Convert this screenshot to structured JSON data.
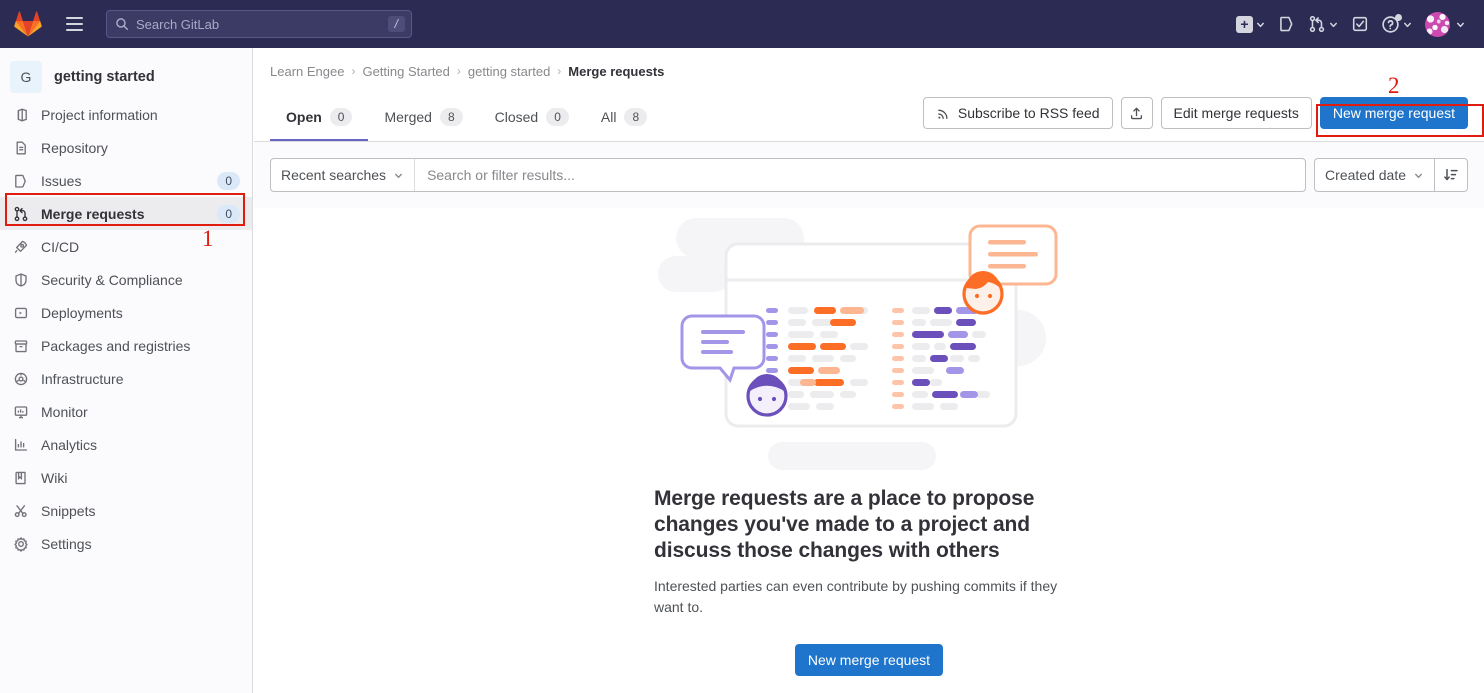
{
  "topbar": {
    "logo_icon": "gitlab-logo-icon",
    "menu_icon": "hamburger-menu-icon",
    "search": {
      "icon": "search-icon",
      "placeholder": "Search GitLab",
      "shortcut_key": "/"
    },
    "actions": [
      {
        "name": "create-new-menu",
        "icon": "plus-square-icon",
        "caret": true
      },
      {
        "name": "issues-link",
        "icon": "issues-icon",
        "caret": false
      },
      {
        "name": "merge-requests-menu",
        "icon": "merge-request-icon",
        "caret": true
      },
      {
        "name": "todos-link",
        "icon": "todo-checkbox-icon",
        "caret": false
      },
      {
        "name": "help-menu",
        "icon": "question-circle-icon",
        "caret": true
      },
      {
        "name": "user-menu",
        "icon": "avatar",
        "caret": true
      }
    ]
  },
  "sidebar": {
    "project": {
      "initial": "G",
      "name": "getting started"
    },
    "items": [
      {
        "label": "Project information",
        "icon": "project-info-icon",
        "badge": null,
        "active": false
      },
      {
        "label": "Repository",
        "icon": "repository-doc-icon",
        "badge": null,
        "active": false
      },
      {
        "label": "Issues",
        "icon": "issues-icon",
        "badge": "0",
        "active": false
      },
      {
        "label": "Merge requests",
        "icon": "merge-request-icon",
        "badge": "0",
        "active": true
      },
      {
        "label": "CI/CD",
        "icon": "rocket-icon",
        "badge": null,
        "active": false
      },
      {
        "label": "Security & Compliance",
        "icon": "shield-icon",
        "badge": null,
        "active": false
      },
      {
        "label": "Deployments",
        "icon": "deployments-icon",
        "badge": null,
        "active": false
      },
      {
        "label": "Packages and registries",
        "icon": "package-icon",
        "badge": null,
        "active": false
      },
      {
        "label": "Infrastructure",
        "icon": "infrastructure-cloud-icon",
        "badge": null,
        "active": false
      },
      {
        "label": "Monitor",
        "icon": "monitor-screen-icon",
        "badge": null,
        "active": false
      },
      {
        "label": "Analytics",
        "icon": "chart-bar-icon",
        "badge": null,
        "active": false
      },
      {
        "label": "Wiki",
        "icon": "book-icon",
        "badge": null,
        "active": false
      },
      {
        "label": "Snippets",
        "icon": "scissors-icon",
        "badge": null,
        "active": false
      },
      {
        "label": "Settings",
        "icon": "gear-icon",
        "badge": null,
        "active": false
      }
    ]
  },
  "breadcrumb": {
    "items": [
      "Learn Engee",
      "Getting Started",
      "getting started"
    ],
    "current": "Merge requests",
    "separator": "›"
  },
  "tabs": [
    {
      "label": "Open",
      "count": "0",
      "active": true
    },
    {
      "label": "Merged",
      "count": "8",
      "active": false
    },
    {
      "label": "Closed",
      "count": "0",
      "active": false
    },
    {
      "label": "All",
      "count": "8",
      "active": false
    }
  ],
  "tab_actions": {
    "rss": {
      "label": "Subscribe to RSS feed",
      "icon": "rss-icon"
    },
    "export": {
      "label": "",
      "icon": "export-upload-icon"
    },
    "edit": {
      "label": "Edit merge requests"
    },
    "new": {
      "label": "New merge request"
    }
  },
  "filters": {
    "recent_searches_label": "Recent searches",
    "recent_searches_icon": "chevron-down-icon",
    "search_placeholder": "Search or filter results...",
    "search_value": "",
    "sort_label": "Created date",
    "sort_icon": "chevron-down-icon",
    "sort_direction_icon": "sort-descending-icon"
  },
  "empty_state": {
    "illustration_icon": "merge-requests-empty-illustration",
    "title": "Merge requests are a place to propose changes you've made to a project and discuss those changes with others",
    "description": "Interested parties can even contribute by pushing commits if they want to.",
    "cta_label": "New merge request"
  },
  "annotations": [
    {
      "number": "1",
      "target": "sidebar-item-merge-requests"
    },
    {
      "number": "2",
      "target": "new-merge-request-button"
    }
  ],
  "colors": {
    "topbar_bg": "#2b2b53",
    "sidebar_bg": "#fbfafd",
    "primary_button": "#1f75cb",
    "active_tab_underline": "#6666c4",
    "annotation_red": "#e01b0f",
    "badge_blue": "#dbe8f7"
  }
}
